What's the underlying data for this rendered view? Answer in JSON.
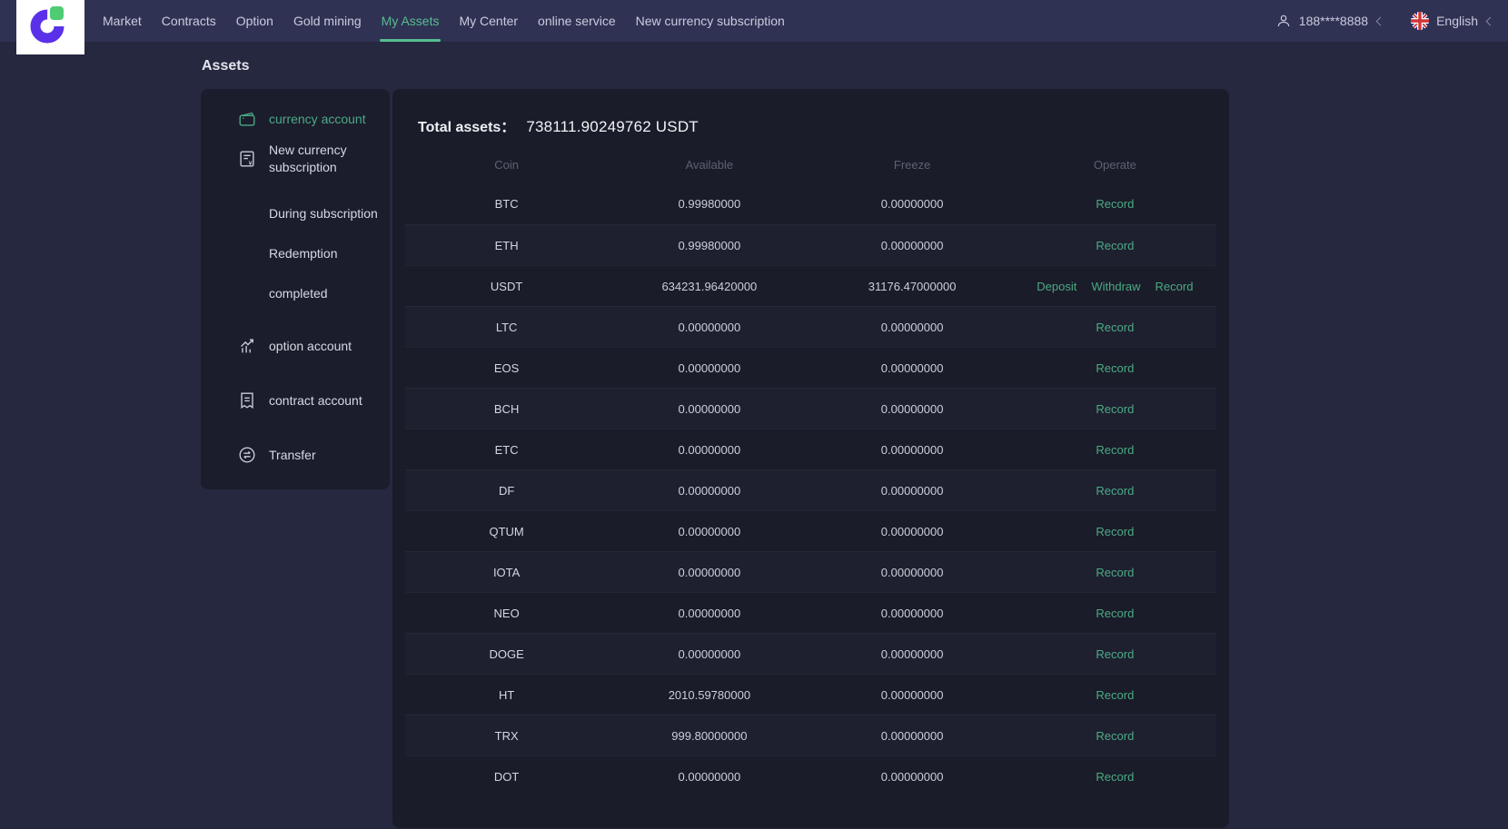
{
  "nav": {
    "items": [
      "Market",
      "Contracts",
      "Option",
      "Gold mining",
      "My Assets",
      "My Center",
      "online service",
      "New currency subscription"
    ],
    "active_item": "My Assets",
    "user_phone": "188****8888",
    "language": "English"
  },
  "page": {
    "title": "Assets"
  },
  "sidebar": {
    "items": [
      {
        "label": "currency account",
        "icon": "wallet-icon",
        "active": true
      },
      {
        "label": "New currency subscription",
        "icon": "document-icon"
      },
      {
        "label": "During subscription",
        "sub": true
      },
      {
        "label": "Redemption",
        "sub": true
      },
      {
        "label": "completed",
        "sub": true
      },
      {
        "label": "option account",
        "icon": "chart-icon"
      },
      {
        "label": "contract account",
        "icon": "contract-icon"
      },
      {
        "label": "Transfer",
        "icon": "transfer-icon"
      }
    ]
  },
  "assets": {
    "total_label": "Total assets：",
    "total_value": "738111.90249762 USDT",
    "table": {
      "headers": [
        "Coin",
        "Available",
        "Freeze",
        "Operate"
      ],
      "rows": [
        {
          "coin": "BTC",
          "available": "0.99980000",
          "freeze": "0.00000000",
          "ops": [
            "Record"
          ]
        },
        {
          "coin": "ETH",
          "available": "0.99980000",
          "freeze": "0.00000000",
          "ops": [
            "Record"
          ]
        },
        {
          "coin": "USDT",
          "available": "634231.96420000",
          "freeze": "31176.47000000",
          "ops": [
            "Deposit",
            "Withdraw",
            "Record"
          ]
        },
        {
          "coin": "LTC",
          "available": "0.00000000",
          "freeze": "0.00000000",
          "ops": [
            "Record"
          ]
        },
        {
          "coin": "EOS",
          "available": "0.00000000",
          "freeze": "0.00000000",
          "ops": [
            "Record"
          ]
        },
        {
          "coin": "BCH",
          "available": "0.00000000",
          "freeze": "0.00000000",
          "ops": [
            "Record"
          ]
        },
        {
          "coin": "ETC",
          "available": "0.00000000",
          "freeze": "0.00000000",
          "ops": [
            "Record"
          ]
        },
        {
          "coin": "DF",
          "available": "0.00000000",
          "freeze": "0.00000000",
          "ops": [
            "Record"
          ]
        },
        {
          "coin": "QTUM",
          "available": "0.00000000",
          "freeze": "0.00000000",
          "ops": [
            "Record"
          ]
        },
        {
          "coin": "IOTA",
          "available": "0.00000000",
          "freeze": "0.00000000",
          "ops": [
            "Record"
          ]
        },
        {
          "coin": "NEO",
          "available": "0.00000000",
          "freeze": "0.00000000",
          "ops": [
            "Record"
          ]
        },
        {
          "coin": "DOGE",
          "available": "0.00000000",
          "freeze": "0.00000000",
          "ops": [
            "Record"
          ]
        },
        {
          "coin": "HT",
          "available": "2010.59780000",
          "freeze": "0.00000000",
          "ops": [
            "Record"
          ]
        },
        {
          "coin": "TRX",
          "available": "999.80000000",
          "freeze": "0.00000000",
          "ops": [
            "Record"
          ]
        },
        {
          "coin": "DOT",
          "available": "0.00000000",
          "freeze": "0.00000000",
          "ops": [
            "Record"
          ]
        }
      ]
    }
  },
  "colors": {
    "accent_green": "#56bd8f",
    "link_green": "#4caa84",
    "nav_bg": "#303254",
    "page_bg": "#26283f",
    "panel_bg": "#1a1c29",
    "logo_purple": "#5a31e8",
    "logo_green": "#4fcb74"
  }
}
